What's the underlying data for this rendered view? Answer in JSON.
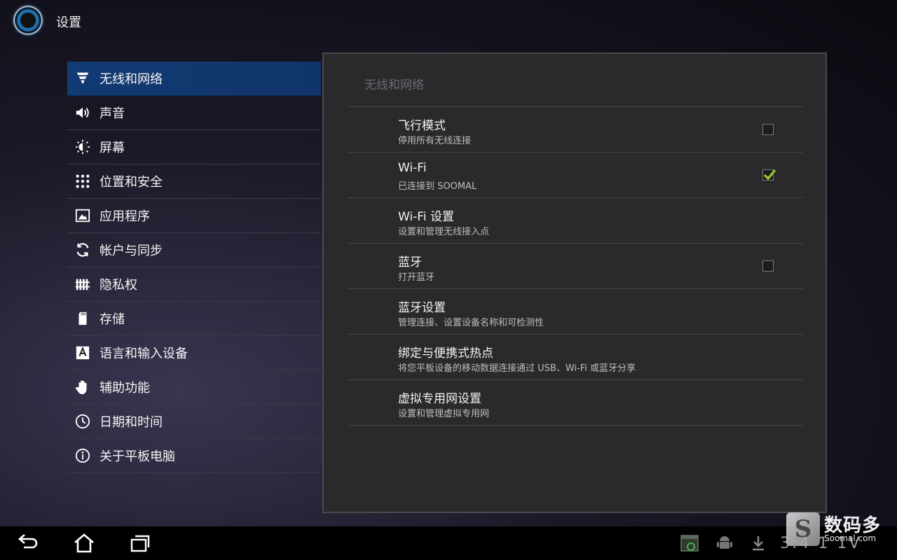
{
  "action_bar": {
    "title": "设置",
    "app_icon": "settings-app-icon"
  },
  "sidebar": {
    "items": [
      {
        "label": "无线和网络",
        "icon": "wireless-icon",
        "active": true
      },
      {
        "label": "声音",
        "icon": "speaker-icon"
      },
      {
        "label": "屏幕",
        "icon": "brightness-icon"
      },
      {
        "label": "位置和安全",
        "icon": "location-grid-icon"
      },
      {
        "label": "应用程序",
        "icon": "applications-icon"
      },
      {
        "label": "帐户与同步",
        "icon": "sync-icon"
      },
      {
        "label": "隐私权",
        "icon": "privacy-fence-icon"
      },
      {
        "label": "存储",
        "icon": "sd-card-icon"
      },
      {
        "label": "语言和输入设备",
        "icon": "keyboard-a-icon"
      },
      {
        "label": "辅助功能",
        "icon": "hand-icon"
      },
      {
        "label": "日期和时间",
        "icon": "clock-icon"
      },
      {
        "label": "关于平板电脑",
        "icon": "info-icon"
      }
    ]
  },
  "panel": {
    "header": "无线和网络",
    "prefs": [
      {
        "title": "飞行模式",
        "summary": "停用所有无线连接",
        "checkbox": true,
        "checked": false
      },
      {
        "title": "Wi-Fi",
        "summary": "已连接到 SOOMAL",
        "checkbox": true,
        "checked": true
      },
      {
        "title": "Wi-Fi 设置",
        "summary": "设置和管理无线接入点",
        "checkbox": false
      },
      {
        "title": "蓝牙",
        "summary": "打开蓝牙",
        "checkbox": true,
        "checked": false
      },
      {
        "title": "蓝牙设置",
        "summary": "管理连接、设置设备名称和可检测性",
        "checkbox": false
      },
      {
        "title": "绑定与便携式热点",
        "summary": "将您平板设备的移动数据连接通过 USB、Wi-Fi 或蓝牙分享",
        "checkbox": false
      },
      {
        "title": "虚拟专用网设置",
        "summary": "设置和管理虚拟专用网",
        "checkbox": false
      }
    ]
  },
  "navbar": {
    "back": "back-icon",
    "home": "home-icon",
    "recents": "recent-apps-icon",
    "clock": "3:4 1 1V"
  },
  "watermark": {
    "logo": "S",
    "text": "数码多",
    "sub": "Soomal.com"
  },
  "colors": {
    "accent": "#123a73",
    "check": "#9acd32"
  }
}
